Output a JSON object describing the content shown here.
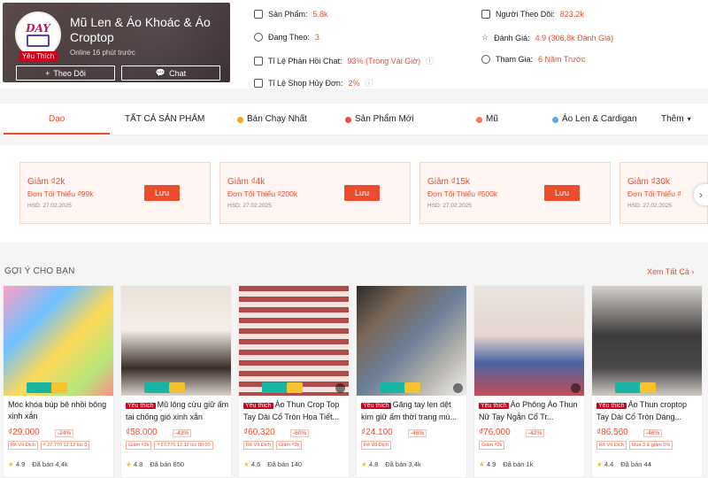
{
  "shop": {
    "avatar_text": "DAY",
    "avatar_subtext": "boutique",
    "favorite_badge": "Yêu Thích",
    "name": "Mũ Len & Áo Khoác & Áo Croptop",
    "online": "Online 16 phút trước",
    "follow_button": "Theo Dõi",
    "chat_button": "Chat"
  },
  "stats": {
    "products_label": "Sản Phẩm:",
    "products_value": "5.8k",
    "following_label": "Đang Theo:",
    "following_value": "3",
    "chat_rate_label": "Tỉ Lệ Phản Hồi Chat:",
    "chat_rate_value": "93% (Trong Vài Giờ)",
    "cancel_rate_label": "Tỉ Lệ Shop Hủy Đơn:",
    "cancel_rate_value": "2%",
    "followers_label": "Người Theo Dõi:",
    "followers_value": "823,2k",
    "rating_label": "Đánh Giá:",
    "rating_value": "4.9 (306,8k Đánh Giá)",
    "joined_label": "Tham Gia:",
    "joined_value": "6 Năm Trước"
  },
  "tabs": [
    {
      "label": "Dạo"
    },
    {
      "label": "TẤT CẢ SẢN PHẨM"
    },
    {
      "label": "Bán Chạy Nhất"
    },
    {
      "label": "Sản Phẩm Mới"
    },
    {
      "label": "Mũ"
    },
    {
      "label": "Áo Len & Cardigan"
    },
    {
      "label": "Thêm"
    }
  ],
  "vouchers": [
    {
      "title": "Giảm ₫2k",
      "min": "Đơn Tối Thiểu ₫99k",
      "date": "HSD: 27.02.2025",
      "button": "Lưu"
    },
    {
      "title": "Giảm ₫4k",
      "min": "Đơn Tối Thiểu ₫200k",
      "date": "HSD: 27.02.2025",
      "button": "Lưu"
    },
    {
      "title": "Giảm ₫15k",
      "min": "Đơn Tối Thiểu ₫500k",
      "date": "HSD: 27.02.2025",
      "button": "Lưu"
    },
    {
      "title": "Giảm ₫30k",
      "min": "Đơn Tối Thiểu ₫",
      "date": "HSD: 27.02.2025",
      "button": ""
    }
  ],
  "suggestions": {
    "title": "GỢI Ý CHO BẠN",
    "see_all": "Xem Tất Cả"
  },
  "products": [
    {
      "fav": "",
      "name": "Móc khóa búp bê nhồi bông xinh xắn",
      "price": "₫29.000",
      "discount": "-24%",
      "tag1": "Rẻ Vô Địch",
      "tag2": "₫ 27.770 12.12 lúc 0",
      "rating": "4.9",
      "sold": "Đã bán 4,4k"
    },
    {
      "fav": "Yêu thích",
      "name": "Mũ lông cừu giữ ấm tai chống gió xinh xắn",
      "price": "₫58.000",
      "discount": "-43%",
      "tag1": "Giảm ₫2k",
      "tag2": "₫ 57.770 12.12 lúc 00:00",
      "rating": "4.8",
      "sold": "Đã bán 850"
    },
    {
      "fav": "Yêu thích",
      "name": "Áo Thun Crop Top Tay Dài Cổ Tròn Họa Tiết...",
      "price": "₫60.320",
      "discount": "-60%",
      "tag1": "Rẻ Vô Địch",
      "tag2": "Giảm ₫2k",
      "rating": "4.6",
      "sold": "Đã bán 140"
    },
    {
      "fav": "Yêu thích",
      "name": "Găng tay len dệt kim giữ ấm thời trang mù...",
      "price": "₫24.100",
      "discount": "-46%",
      "tag1": "Rẻ Vô Địch",
      "tag2": "",
      "rating": "4.8",
      "sold": "Đã bán 3,4k"
    },
    {
      "fav": "Yêu thích",
      "name": "Áo Phông Áo Thun Nữ Tay Ngắn Cổ Tr...",
      "price": "₫76.000",
      "discount": "-42%",
      "tag1": "Giảm ₫2k",
      "tag2": "",
      "rating": "4.9",
      "sold": "Đã bán 1k"
    },
    {
      "fav": "Yêu thích",
      "name": "Áo Thun croptop Tay Dài Cổ Tròn Dáng...",
      "price": "₫86.560",
      "discount": "-46%",
      "tag1": "Rẻ Vô Địch",
      "tag2": "Mua 3 & giảm 5%",
      "rating": "4.4",
      "sold": "Đã bán 44"
    }
  ],
  "colors": {
    "accent": "#ee4d2d",
    "badge": "#d0011b"
  }
}
